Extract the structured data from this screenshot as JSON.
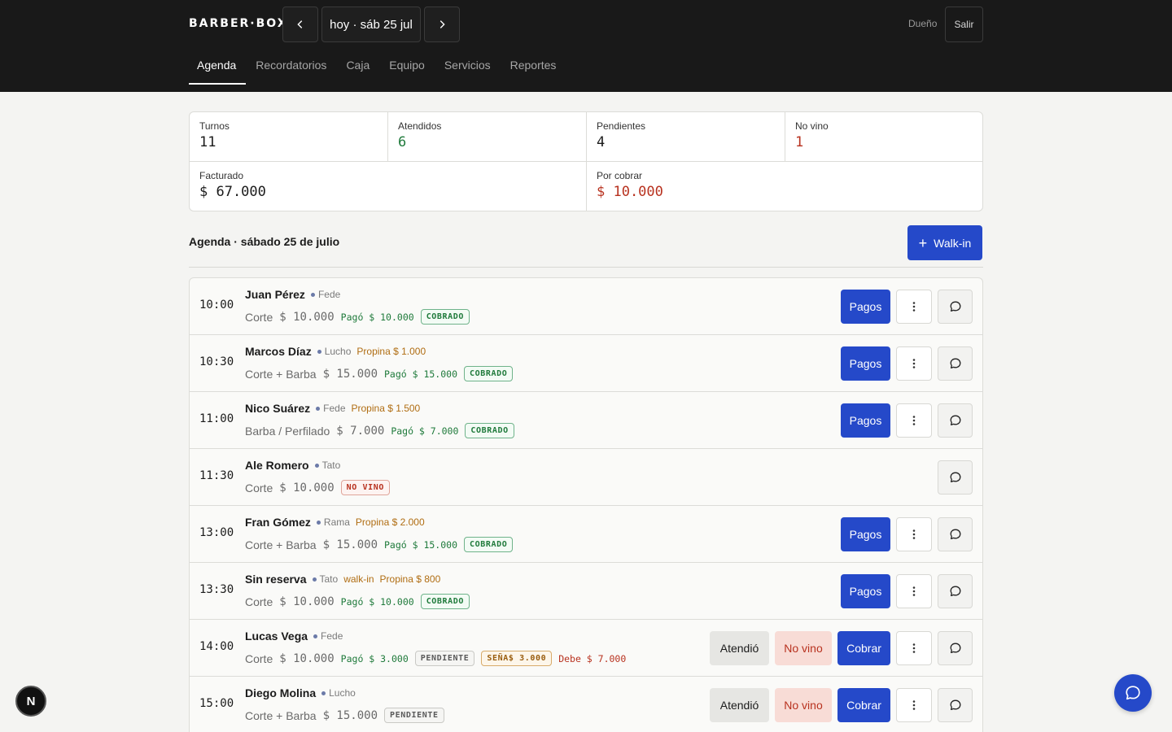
{
  "header": {
    "brand": "BARBER·BOX",
    "date_label": "hoy · sáb 25 jul",
    "owner_label": "Dueño",
    "logout_label": "Salir"
  },
  "tabs": [
    {
      "label": "Agenda",
      "active": true
    },
    {
      "label": "Recordatorios"
    },
    {
      "label": "Caja"
    },
    {
      "label": "Equipo"
    },
    {
      "label": "Servicios"
    },
    {
      "label": "Reportes"
    }
  ],
  "stats": {
    "turnos": {
      "label": "Turnos",
      "value": "11"
    },
    "atendidos": {
      "label": "Atendidos",
      "value": "6"
    },
    "pendientes": {
      "label": "Pendientes",
      "value": "4"
    },
    "no_vino": {
      "label": "No vino",
      "value": "1"
    },
    "facturado": {
      "label": "Facturado",
      "value": "$ 67.000"
    },
    "por_cobrar": {
      "label": "Por cobrar",
      "value": "$ 10.000"
    }
  },
  "agenda": {
    "title": "Agenda · sábado 25 de julio",
    "walkin_label": "Walk-in"
  },
  "buttons": {
    "pagos": "Pagos",
    "atendio": "Atendió",
    "no_vino": "No vino",
    "cobrar": "Cobrar"
  },
  "appointments": [
    {
      "time": "10:00",
      "client": "Juan Pérez",
      "barber": "Fede",
      "service": "Corte",
      "price": "$ 10.000",
      "paid": "Pagó $ 10.000",
      "status": "COBRADO"
    },
    {
      "time": "10:30",
      "client": "Marcos Díaz",
      "barber": "Lucho",
      "tip": "Propina $ 1.000",
      "service": "Corte + Barba",
      "price": "$ 15.000",
      "paid": "Pagó $ 15.000",
      "status": "COBRADO"
    },
    {
      "time": "11:00",
      "client": "Nico Suárez",
      "barber": "Fede",
      "tip": "Propina $ 1.500",
      "service": "Barba / Perfilado",
      "price": "$ 7.000",
      "paid": "Pagó $ 7.000",
      "status": "COBRADO"
    },
    {
      "time": "11:30",
      "client": "Ale Romero",
      "barber": "Tato",
      "service": "Corte",
      "price": "$ 10.000",
      "status": "NO VINO"
    },
    {
      "time": "13:00",
      "client": "Fran Gómez",
      "barber": "Rama",
      "tip": "Propina $ 2.000",
      "service": "Corte + Barba",
      "price": "$ 15.000",
      "paid": "Pagó $ 15.000",
      "status": "COBRADO"
    },
    {
      "time": "13:30",
      "client": "Sin reserva",
      "barber": "Tato",
      "walkin": "walk-in",
      "tip": "Propina $ 800",
      "service": "Corte",
      "price": "$ 10.000",
      "paid": "Pagó $ 10.000",
      "status": "COBRADO"
    },
    {
      "time": "14:00",
      "client": "Lucas Vega",
      "barber": "Fede",
      "service": "Corte",
      "price": "$ 10.000",
      "paid": "Pagó $ 3.000",
      "status": "PENDIENTE",
      "deposit": "SEÑA$ 3.000",
      "owed": "Debe $ 7.000"
    },
    {
      "time": "15:00",
      "client": "Diego Molina",
      "barber": "Lucho",
      "service": "Corte + Barba",
      "price": "$ 15.000",
      "status": "PENDIENTE"
    }
  ],
  "misc": {
    "next_badge": "N"
  },
  "colors": {
    "accent": "#2549c9",
    "topbar": "#191919",
    "success": "#1f7a3b",
    "danger": "#b8321f",
    "warning": "#b06d12"
  }
}
